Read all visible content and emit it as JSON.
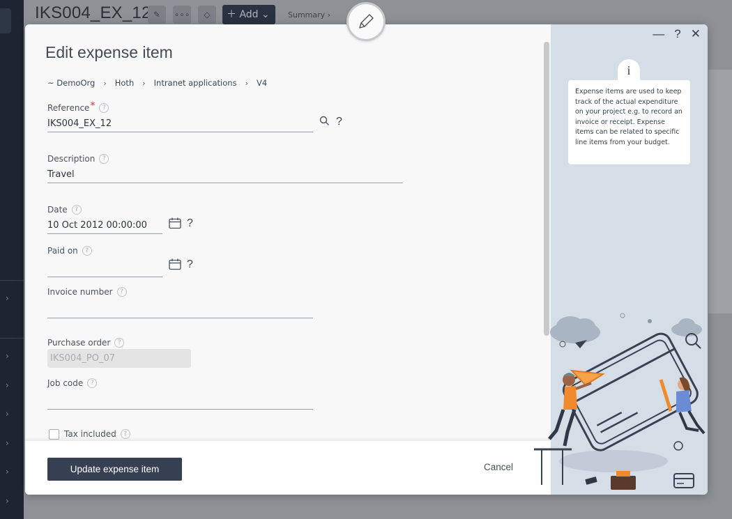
{
  "background": {
    "page_title": "IKS004_EX_12",
    "add_label": "Add",
    "summary_label": "Summary ›"
  },
  "modal": {
    "title": "Edit expense item",
    "breadcrumbs": [
      "~ DemoOrg",
      "Hoth",
      "Intranet applications",
      "V4"
    ],
    "window_controls": {
      "minimize": "—",
      "help": "?",
      "close": "✕"
    },
    "fields": {
      "reference": {
        "label": "Reference",
        "value": "IKS004_EX_12"
      },
      "description": {
        "label": "Description",
        "value": "Travel"
      },
      "date": {
        "label": "Date",
        "value": "10 Oct 2012 00:00:00"
      },
      "paid_on": {
        "label": "Paid on",
        "value": ""
      },
      "invoice_number": {
        "label": "Invoice number",
        "value": ""
      },
      "purchase_order": {
        "label": "Purchase order",
        "value": "IKS004_PO_07"
      },
      "job_code": {
        "label": "Job code",
        "value": ""
      },
      "tax_included": {
        "label": "Tax included",
        "checked": false
      }
    },
    "help_mark": "?",
    "info": {
      "tab_glyph": "i",
      "text": "Expense items are used to keep track of the actual expenditure on your project e.g. to record an invoice or receipt. Expense items can be related to specific line items from your budget."
    },
    "footer": {
      "update_label": "Update expense item",
      "cancel_label": "Cancel"
    }
  },
  "colors": {
    "primary": "#364052",
    "required": "#d9302c",
    "panel": "#d5dde6",
    "illustration_orange": "#f08a2c"
  }
}
